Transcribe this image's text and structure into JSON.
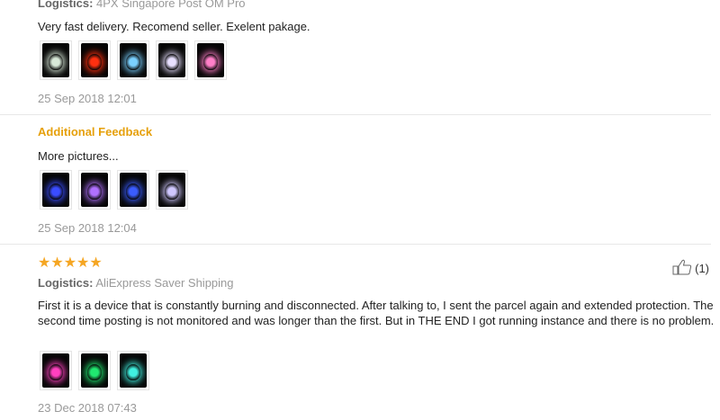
{
  "review1": {
    "logistics_label": "Logistics:",
    "logistics_value": "4PX Singapore Post OM Pro",
    "text": "Very fast delivery. Recomend seller. Exelent pakage.",
    "photos": [
      "#d8e8d8",
      "#ff3010",
      "#7ad0ff",
      "#e8e0ff",
      "#ff7fc8"
    ],
    "date": "25 Sep 2018 12:01"
  },
  "additional": {
    "title": "Additional Feedback",
    "text": "More pictures...",
    "photos": [
      "#3a4cff",
      "#b070ff",
      "#3a5cff",
      "#d0c8ff"
    ],
    "date": "25 Sep 2018 12:04"
  },
  "review2": {
    "rating": 5,
    "helpful_count": "(1)",
    "logistics_label": "Logistics:",
    "logistics_value": "AliExpress Saver Shipping",
    "text": "First it is a device that is constantly burning and disconnected. After talking to, I sent the parcel again and extended protection. The second time posting is not monitored and was longer than the first. But in THE END I got running instance and there is no problem.",
    "photos": [
      "#ff40c0",
      "#20e870",
      "#40f0e0"
    ],
    "date": "23 Dec 2018 07:43"
  },
  "colors": {
    "star": "#f5a623",
    "accent": "#e6a00b"
  },
  "icons": {
    "helpful": "thumbs-up-icon",
    "star": "star-icon"
  }
}
